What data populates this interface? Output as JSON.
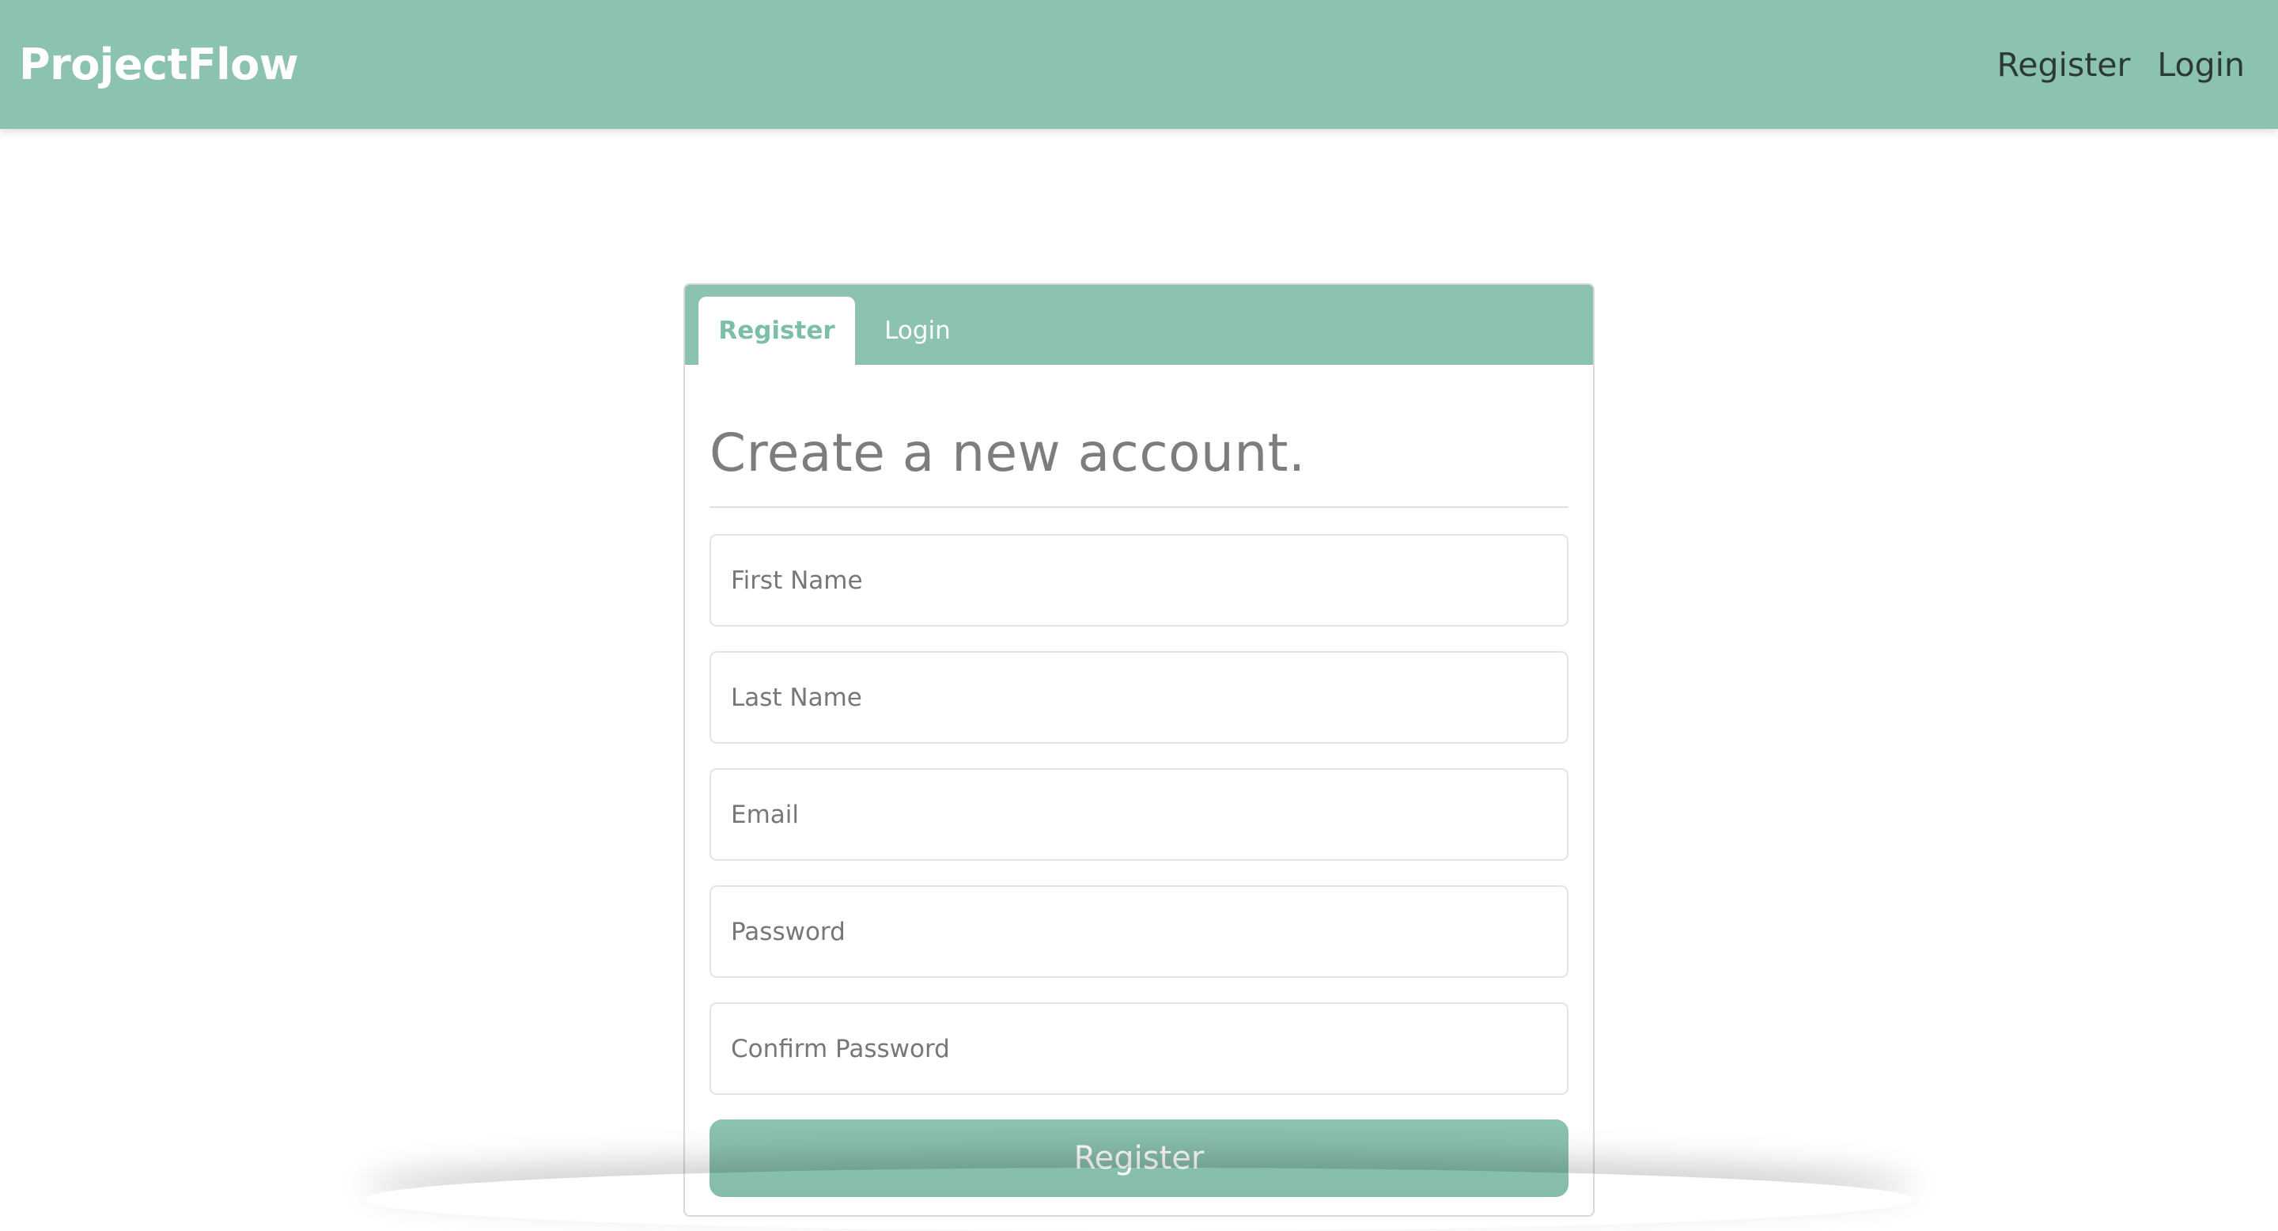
{
  "navbar": {
    "brand": "ProjectFlow",
    "links": [
      {
        "label": "Register"
      },
      {
        "label": "Login"
      }
    ]
  },
  "auth_card": {
    "tabs": [
      {
        "label": "Register",
        "active": true
      },
      {
        "label": "Login",
        "active": false
      }
    ],
    "heading": "Create a new account.",
    "fields": {
      "first_name": {
        "placeholder": "First Name",
        "value": ""
      },
      "last_name": {
        "placeholder": "Last Name",
        "value": ""
      },
      "email": {
        "placeholder": "Email",
        "value": ""
      },
      "password": {
        "placeholder": "Password",
        "value": ""
      },
      "confirm_password": {
        "placeholder": "Confirm Password",
        "value": ""
      }
    },
    "submit_label": "Register"
  },
  "colors": {
    "accent": "#8bc3ae",
    "active_tab_text": "#7cbfa6",
    "heading_text": "#7d7d7d",
    "nav_link_text": "#2b3a36"
  }
}
